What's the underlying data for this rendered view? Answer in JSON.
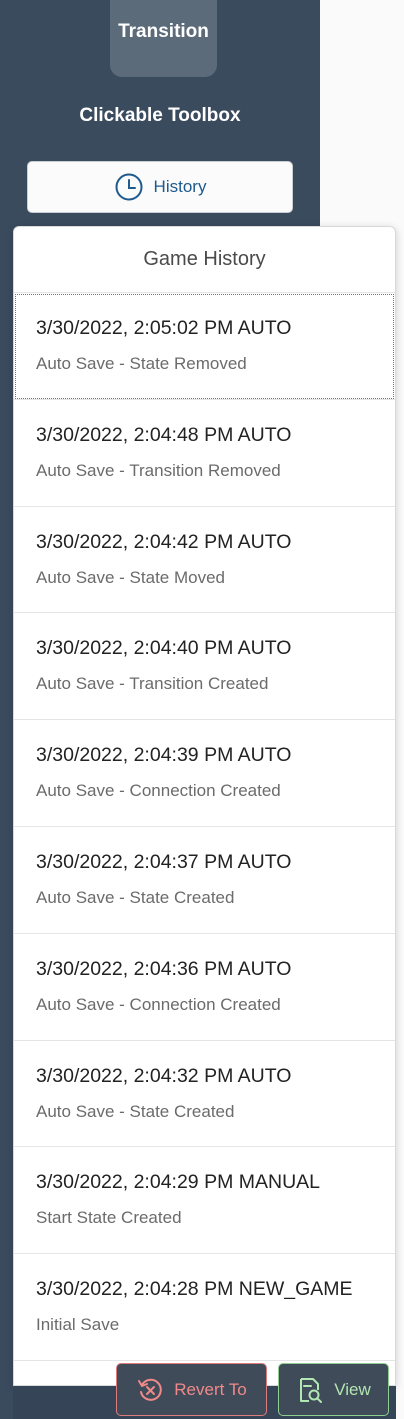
{
  "toolbox": {
    "transition_label": "Transition",
    "title": "Clickable Toolbox",
    "history_button_label": "History"
  },
  "popover": {
    "title": "Game History",
    "items": [
      {
        "title": "3/30/2022, 2:05:02 PM AUTO",
        "subtitle": "Auto Save - State Removed"
      },
      {
        "title": "3/30/2022, 2:04:48 PM AUTO",
        "subtitle": "Auto Save - Transition Removed"
      },
      {
        "title": "3/30/2022, 2:04:42 PM AUTO",
        "subtitle": "Auto Save - State Moved"
      },
      {
        "title": "3/30/2022, 2:04:40 PM AUTO",
        "subtitle": "Auto Save - Transition Created"
      },
      {
        "title": "3/30/2022, 2:04:39 PM AUTO",
        "subtitle": "Auto Save - Connection Created"
      },
      {
        "title": "3/30/2022, 2:04:37 PM AUTO",
        "subtitle": "Auto Save - State Created"
      },
      {
        "title": "3/30/2022, 2:04:36 PM AUTO",
        "subtitle": "Auto Save - Connection Created"
      },
      {
        "title": "3/30/2022, 2:04:32 PM AUTO",
        "subtitle": "Auto Save - State Created"
      },
      {
        "title": "3/30/2022, 2:04:29 PM MANUAL",
        "subtitle": "Start State Created"
      },
      {
        "title": "3/30/2022, 2:04:28 PM NEW_GAME",
        "subtitle": "Initial Save"
      }
    ]
  },
  "actions": {
    "revert_label": "Revert To",
    "view_label": "View"
  },
  "colors": {
    "sidebar_bg": "#3b4b5e",
    "accent_blue": "#1d5a8e",
    "revert_red": "#f08a8a",
    "view_green": "#b2e6b2"
  }
}
